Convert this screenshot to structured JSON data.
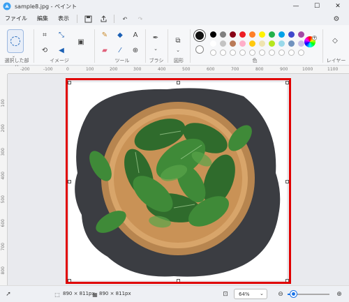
{
  "window": {
    "title": "sample8.jpg - ペイント"
  },
  "menu": {
    "items": [
      "ファイル",
      "編集",
      "表示"
    ]
  },
  "ribbon": {
    "groups": [
      "選択した部分",
      "イメージ",
      "ツール",
      "ブラシ",
      "図形",
      "色",
      "レイヤー"
    ]
  },
  "palette": {
    "row1": [
      "#000000",
      "#7f7f7f",
      "#880015",
      "#ed1c24",
      "#ff7f27",
      "#fff200",
      "#22b14c",
      "#00a2e8",
      "#3f48cc",
      "#a349a4"
    ],
    "row2": [
      "#ffffff",
      "#c3c3c3",
      "#b97a57",
      "#ffaec9",
      "#ffc90e",
      "#efe4b0",
      "#b5e61d",
      "#99d9ea",
      "#7092be",
      "#c8bfe7"
    ]
  },
  "ruler": {
    "top": [
      "-200",
      "-100",
      "0",
      "100",
      "200",
      "300",
      "400",
      "500",
      "600",
      "700",
      "800",
      "900",
      "1000",
      "1100"
    ],
    "left": [
      "100",
      "200",
      "300",
      "400",
      "500",
      "600",
      "700",
      "800"
    ]
  },
  "status": {
    "selection_size": "890 × 811px",
    "image_size": "890 × 811px",
    "zoom": "64%"
  }
}
